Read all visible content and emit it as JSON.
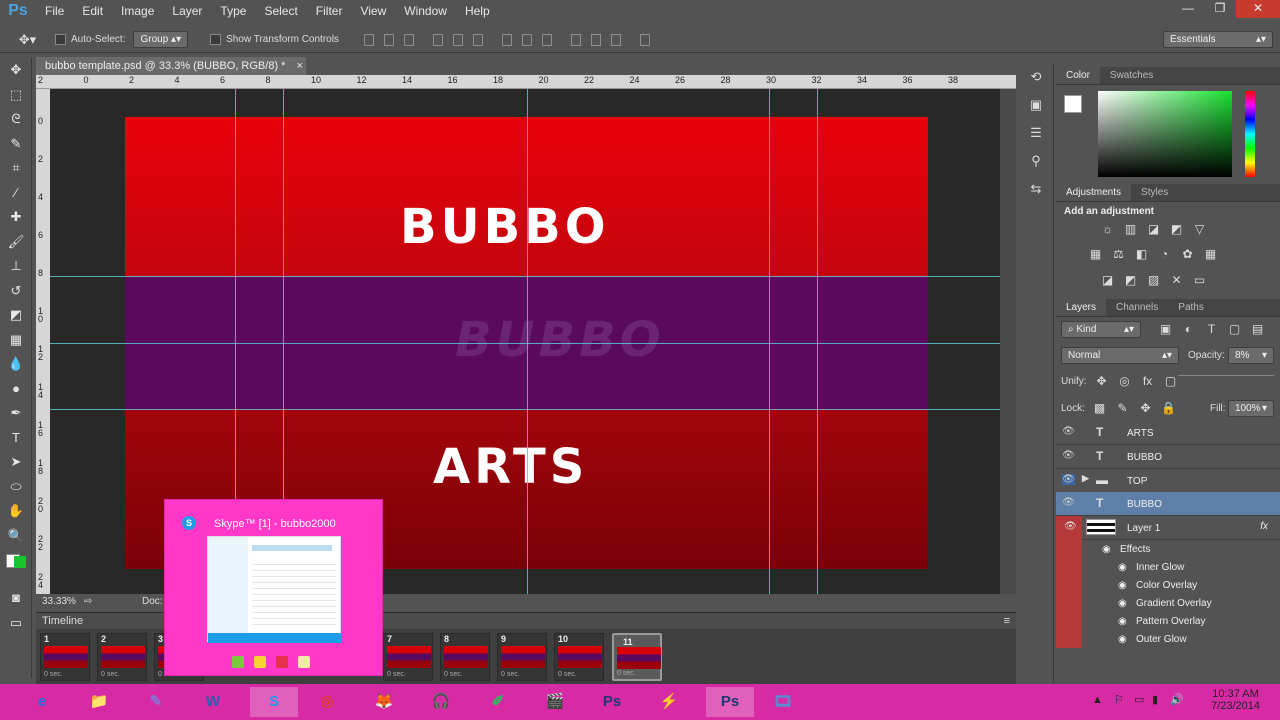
{
  "app": {
    "logo": "Ps",
    "menus": [
      "File",
      "Edit",
      "Image",
      "Layer",
      "Type",
      "Select",
      "Filter",
      "View",
      "Window",
      "Help"
    ]
  },
  "window_controls": {
    "minimize": "—",
    "restore": "❐",
    "close": "✕"
  },
  "options_bar": {
    "auto_select_label": "Auto-Select:",
    "auto_select_value": "Group",
    "show_transform_label": "Show Transform Controls",
    "workspace": "Essentials"
  },
  "document": {
    "tab_title": "bubbo template.psd @ 33.3% (BUBBO, RGB/8) *",
    "close": "×",
    "zoom": "33.33%",
    "doc_label": "Doc:"
  },
  "ruler": {
    "top": [
      "2",
      "0",
      "2",
      "4",
      "6",
      "8",
      "10",
      "12",
      "14",
      "16",
      "18",
      "20",
      "22",
      "24",
      "26",
      "28",
      "30",
      "32",
      "34",
      "36",
      "38"
    ],
    "left": [
      "0",
      "2",
      "4",
      "6",
      "8",
      "1\n0",
      "1\n2",
      "1\n4",
      "1\n6",
      "1\n8",
      "2\n0",
      "2\n2",
      "2\n4"
    ]
  },
  "canvas": {
    "title_text": "BUBBO",
    "watermark_text": "BUBBO",
    "bottom_text": "ARTS",
    "colors": {
      "top_band": "#e8000a",
      "mid_band": "#5a0a5e",
      "bottom_band": "#8c0209",
      "guide": "#58c7d6"
    }
  },
  "timeline": {
    "title": "Timeline",
    "frames": [
      {
        "num": "1",
        "selected": false
      },
      {
        "num": "2",
        "selected": false
      },
      {
        "num": "3",
        "selected": false
      },
      {
        "num": "7",
        "selected": false
      },
      {
        "num": "8",
        "selected": false
      },
      {
        "num": "9",
        "selected": false
      },
      {
        "num": "10",
        "selected": false
      },
      {
        "num": "11",
        "selected": true
      }
    ],
    "frame_delay": "0 sec."
  },
  "skype_popup": {
    "title": "Skype™ [1] - bubbo2000",
    "icon": "S"
  },
  "panels": {
    "color_tabs": [
      "Color",
      "Swatches"
    ],
    "adjust_tabs": [
      "Adjustments",
      "Styles"
    ],
    "add_adjustment": "Add an adjustment",
    "layers_tabs": [
      "Layers",
      "Channels",
      "Paths"
    ],
    "filter_kind": "Kind",
    "blend_mode": "Normal",
    "opacity_label": "Opacity:",
    "opacity_value": "8%",
    "unify_label": "Unify:",
    "lock_label": "Lock:",
    "fill_label": "Fill:",
    "fill_value": "100%"
  },
  "layers": [
    {
      "name": "ARTS",
      "kind": "T",
      "visible": true,
      "selected": false
    },
    {
      "name": "BUBBO",
      "kind": "T",
      "visible": true,
      "selected": false
    },
    {
      "name": "TOP",
      "kind": "folder",
      "visible": true,
      "selected": false
    },
    {
      "name": "BUBBO",
      "kind": "T",
      "visible": true,
      "selected": true
    },
    {
      "name": "Layer 1",
      "kind": "image",
      "visible": true,
      "selected": false,
      "fx": "fx"
    }
  ],
  "effects_label": "Effects",
  "effects": [
    "Inner Glow",
    "Color Overlay",
    "Gradient Overlay",
    "Pattern Overlay",
    "Outer Glow"
  ],
  "taskbar": {
    "time": "10:37 AM",
    "date": "7/23/2014",
    "apps": [
      "e",
      "📁",
      "✎",
      "W",
      "S",
      "◎",
      "🦊",
      "🎧",
      "✐",
      "🎬",
      "Ps",
      "⚡",
      "Ps",
      "🎞"
    ]
  }
}
